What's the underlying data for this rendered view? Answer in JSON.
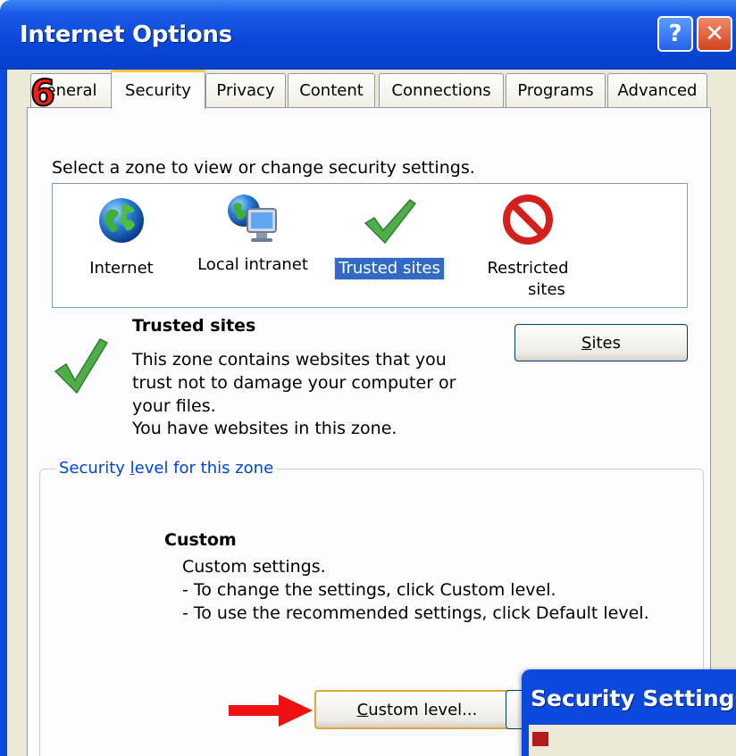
{
  "window": {
    "title": "Internet Options",
    "help_glyph": "?",
    "close_glyph": "✕"
  },
  "step_badge": "6",
  "tabs": [
    {
      "label": "eneral"
    },
    {
      "label": "Security"
    },
    {
      "label": "Privacy"
    },
    {
      "label": "Content"
    },
    {
      "label": "Connections"
    },
    {
      "label": "Programs"
    },
    {
      "label": "Advanced"
    }
  ],
  "security": {
    "instruction": "Select a zone to view or change security settings.",
    "zones": [
      {
        "label": "Internet",
        "icon": "globe-icon"
      },
      {
        "label": "Local intranet",
        "icon": "intranet-monitor-icon"
      },
      {
        "label": "Trusted sites",
        "icon": "checkmark-icon"
      },
      {
        "label_line1": "Restricted",
        "label_line2": "sites",
        "icon": "restricted-icon"
      }
    ],
    "selected_zone": {
      "title": "Trusted sites",
      "desc1": "This zone contains websites that you",
      "desc2": "trust not to damage your computer or",
      "desc3": "your files.",
      "desc4": "You have websites in this zone."
    },
    "sites_button": {
      "prefix": "",
      "underline": "S",
      "rest": "ites"
    }
  },
  "level": {
    "legend_pre": "Security ",
    "legend_ul": "l",
    "legend_post": "evel for this zone",
    "name": "Custom",
    "line1": "Custom settings.",
    "line2": "- To change the settings, click Custom level.",
    "line3": "- To use the recommended settings, click Default level.",
    "custom_button": {
      "underline": "C",
      "rest": "ustom level..."
    }
  },
  "popup": {
    "title": "Security Settings -"
  },
  "colors": {
    "titlebar": "#0a49dc",
    "selection": "#316ac5",
    "arrow": "#ee1111",
    "badge": "#ff1a1a"
  }
}
